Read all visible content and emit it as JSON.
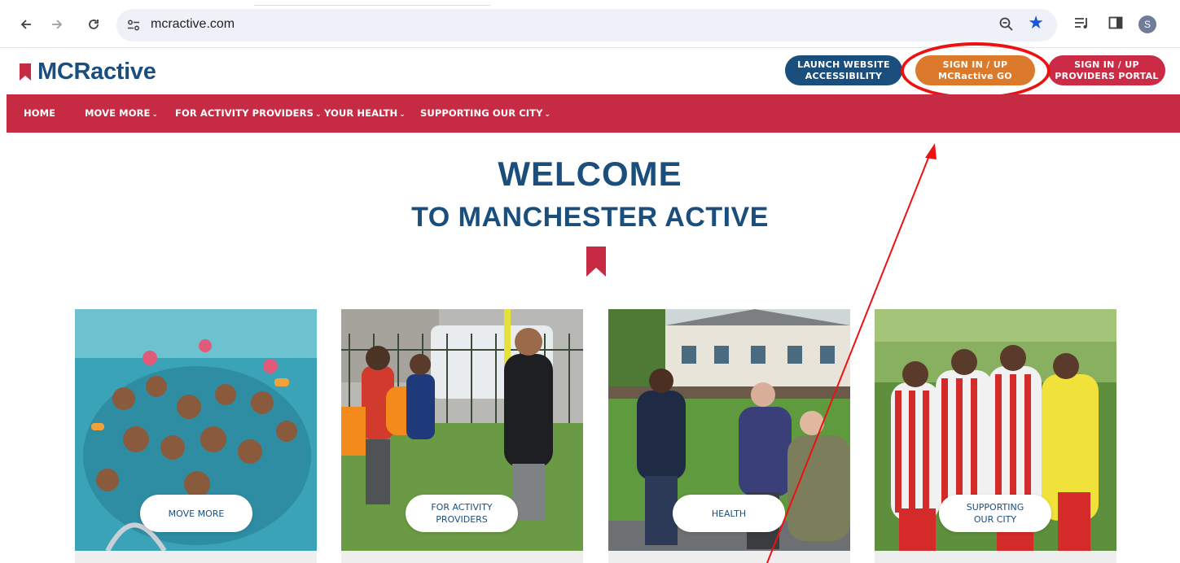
{
  "browser": {
    "url": "mcractive.com",
    "avatar_initial": "S",
    "accent_color": "#1a57d6"
  },
  "site": {
    "logo_text": "MCRactive",
    "brand_colors": {
      "navy": "#1a4e7d",
      "red": "#c72b44",
      "orange": "#db7a2b"
    },
    "header_buttons": {
      "accessibility": {
        "line1": "LAUNCH WEBSITE",
        "line2": "ACCESSIBILITY"
      },
      "go": {
        "line1": "SIGN IN / UP",
        "line2": "MCRactive GO"
      },
      "portal": {
        "line1": "SIGN IN / UP",
        "line2": "PROVIDERS PORTAL"
      }
    },
    "nav": [
      {
        "label": "HOME"
      },
      {
        "label": "MOVE MORE"
      },
      {
        "label": "FOR ACTIVITY PROVIDERS"
      },
      {
        "label": "YOUR HEALTH"
      },
      {
        "label": "SUPPORTING OUR CITY"
      }
    ],
    "welcome": {
      "line1": "WELCOME",
      "line2": "TO MANCHESTER ACTIVE"
    },
    "cards": [
      {
        "line1": "MOVE MORE",
        "line2": "",
        "image": "children-swimming-pool-photo"
      },
      {
        "line1": "FOR ACTIVITY",
        "line2": "PROVIDERS",
        "image": "coach-with-kids-photo"
      },
      {
        "line1": "HEALTH",
        "line2": "",
        "image": "older-adults-walking-photo"
      },
      {
        "line1": "SUPPORTING",
        "line2": "OUR CITY",
        "image": "youth-football-team-huddle-photo"
      }
    ]
  }
}
